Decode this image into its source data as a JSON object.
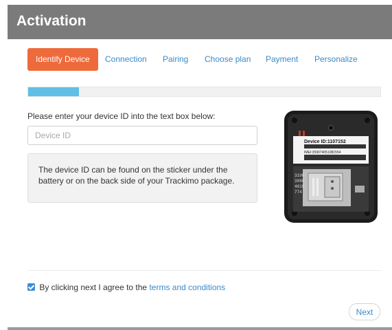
{
  "dialog": {
    "title": "Activation",
    "close_glyph": "×"
  },
  "tabs": [
    {
      "label": "Identify Device",
      "active": true
    },
    {
      "label": "Connection",
      "active": false
    },
    {
      "label": "Pairing",
      "active": false
    },
    {
      "label": "Choose plan",
      "active": false
    },
    {
      "label": "Payment",
      "active": false
    },
    {
      "label": "Personalize",
      "active": false
    }
  ],
  "progress": {
    "fraction": 0.145
  },
  "form": {
    "instruction": "Please enter your device ID into the text box below:",
    "device_id_value": "",
    "device_id_placeholder": "Device ID",
    "info_text": "The device ID can be found on the sticker under the battery or on the back side of your Trackimo package."
  },
  "device_image": {
    "sticker_device_id": "Device ID:1107152",
    "sticker_imei": "IMEI:359074051081554",
    "side_digits": [
      "3100",
      "3080",
      "4619",
      "774"
    ]
  },
  "agreement": {
    "checked": true,
    "prefix": "By clicking next I agree to the",
    "link_text": "terms and conditions"
  },
  "actions": {
    "next_label": "Next"
  },
  "colors": {
    "header_bg": "#7b7b7b",
    "active_tab": "#ee6a3b",
    "link": "#3a8ac7",
    "progress_fill": "#5fbfe5"
  }
}
